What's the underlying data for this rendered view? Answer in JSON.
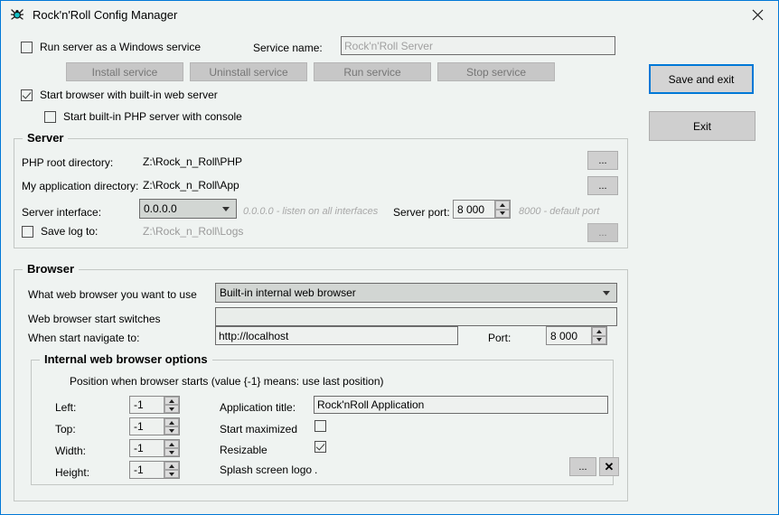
{
  "window": {
    "title": "Rock'n'Roll Config Manager",
    "icon": "spider-app-icon",
    "close_label": "✕",
    "accent_color": "#0078d7",
    "background_color": "#eff3f1"
  },
  "service": {
    "run_as_service_label": "Run server as a Windows service",
    "run_as_service_checked": false,
    "service_name_label": "Service name:",
    "service_name_value": "Rock'n'Roll Server",
    "buttons": [
      {
        "label": "Install service",
        "enabled": false
      },
      {
        "label": "Uninstall service",
        "enabled": false
      },
      {
        "label": "Run service",
        "enabled": false
      },
      {
        "label": "Stop service",
        "enabled": false
      }
    ],
    "start_browser_label": "Start browser with built-in web server",
    "start_browser_checked": true,
    "start_php_console_label": "Start built-in PHP server with console",
    "start_php_console_checked": false
  },
  "actions": {
    "save_and_exit_label": "Save and  exit",
    "exit_label": "Exit"
  },
  "server": {
    "title": "Server",
    "php_root_label": "PHP root directory:",
    "php_root_value": "Z:\\Rock_n_Roll\\PHP",
    "app_dir_label": "My application directory:",
    "app_dir_value": "Z:\\Rock_n_Roll\\App",
    "interface_label": "Server interface:",
    "interface_value": "0.0.0.0",
    "interface_hint": "0.0.0.0  - listen on all interfaces",
    "port_label": "Server port:",
    "port_value": "8 000",
    "port_hint": "8000 - default port",
    "save_log_label": "Save log to:",
    "save_log_checked": false,
    "save_log_value": "Z:\\Rock_n_Roll\\Logs",
    "browse_label": "...",
    "browse_buttons": [
      {
        "name": "browse-php-root",
        "enabled": true
      },
      {
        "name": "browse-app-dir",
        "enabled": true
      },
      {
        "name": "browse-log-dir",
        "enabled": false
      }
    ]
  },
  "browser": {
    "title": "Browser",
    "which_browser_label": "What web browser you want to use",
    "which_browser_value": "Built-in internal web browser",
    "switches_label": "Web browser start switches",
    "switches_value": "",
    "navigate_label": "When start navigate to:",
    "navigate_value": "http://localhost",
    "port_label": "Port:",
    "port_value": "8 000"
  },
  "internal_options": {
    "title": "Internal web browser options",
    "position_note": "Position when browser starts (value {-1} means: use last position)",
    "fields": [
      {
        "label": "Left:",
        "value": "-1"
      },
      {
        "label": "Top:",
        "value": "-1"
      },
      {
        "label": "Width:",
        "value": "-1"
      },
      {
        "label": "Height:",
        "value": "-1"
      }
    ],
    "app_title_label": "Application title:",
    "app_title_value": "Rock'nRoll Application",
    "start_maximized_label": "Start maximized",
    "start_maximized_checked": false,
    "resizable_label": "Resizable",
    "resizable_checked": true,
    "splash_label": "Splash screen logo",
    "splash_value": ".",
    "splash_browse_label": "...",
    "splash_clear_label": "✕"
  }
}
